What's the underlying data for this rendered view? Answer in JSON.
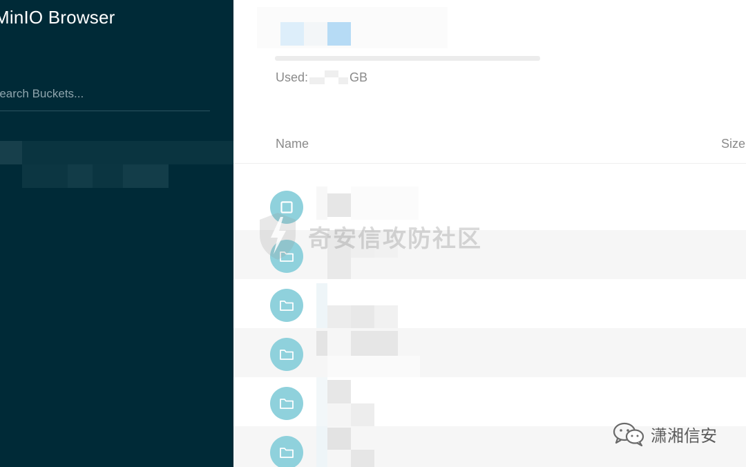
{
  "sidebar": {
    "app_title": "MinIO Browser",
    "search_placeholder": "Search Buckets..."
  },
  "storage": {
    "used_label": "Used:",
    "used_value": "",
    "used_unit": "GB"
  },
  "table": {
    "columns": {
      "name": "Name",
      "size": "Size"
    },
    "rows": [
      {
        "type": "object",
        "icon": "file-icon",
        "name": ""
      },
      {
        "type": "folder",
        "icon": "folder-icon",
        "name": ""
      },
      {
        "type": "folder",
        "icon": "folder-icon",
        "name": ""
      },
      {
        "type": "folder",
        "icon": "folder-icon",
        "name": ""
      },
      {
        "type": "folder",
        "icon": "folder-icon",
        "name": ""
      },
      {
        "type": "folder",
        "icon": "folder-icon",
        "name": ""
      }
    ]
  },
  "watermarks": {
    "center": "奇安信攻防社区",
    "corner": "潇湘信安"
  },
  "colors": {
    "sidebar_bg": "#002a37",
    "icon_bg": "#8fd1dc",
    "text_muted": "#8a8a8a"
  }
}
